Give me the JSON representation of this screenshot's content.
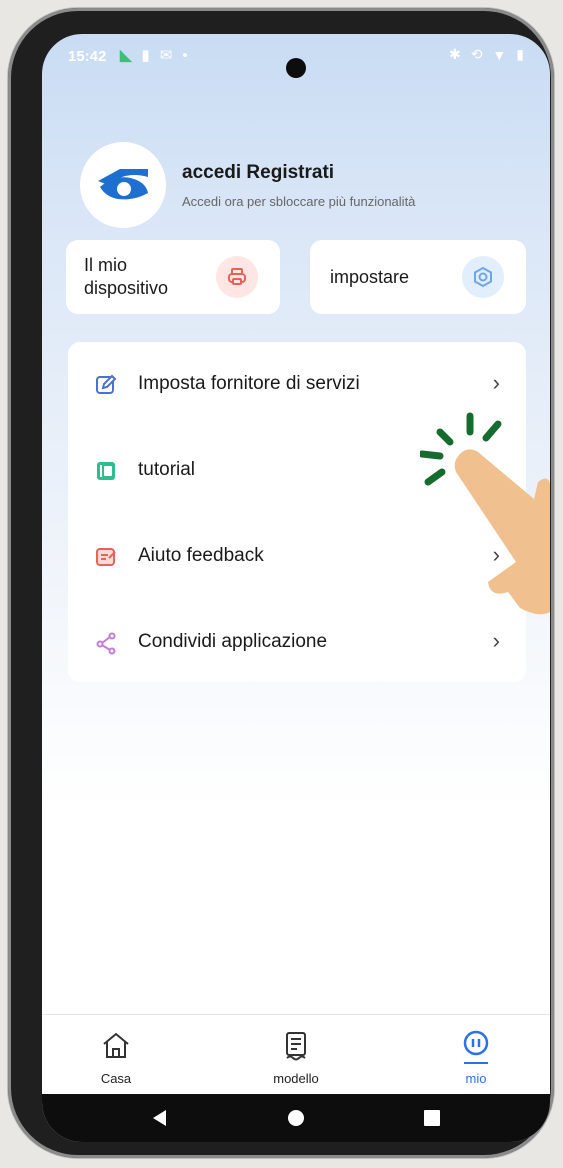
{
  "status_bar": {
    "time": "15:42",
    "left_icons": [
      "calculator-icon",
      "sim-icon",
      "mail-icon",
      "dot-icon"
    ],
    "right_icons": [
      "bluetooth-icon",
      "sync-icon",
      "wifi-icon",
      "battery-icon"
    ]
  },
  "profile": {
    "title": "accedi Registrati",
    "subtitle": "Accedi ora per sbloccare più funzionalità",
    "avatar_icon": "logo-icon"
  },
  "cards": [
    {
      "label": "Il mio dispositivo",
      "icon": "printer-icon"
    },
    {
      "label": "impostare",
      "icon": "settings-icon"
    }
  ],
  "menu": {
    "items": [
      {
        "label": "Imposta fornitore di servizi",
        "icon": "edit-icon"
      },
      {
        "label": "tutorial",
        "icon": "book-icon"
      },
      {
        "label": "Aiuto feedback",
        "icon": "feedback-icon"
      },
      {
        "label": "Condividi applicazione",
        "icon": "share-icon"
      }
    ]
  },
  "tabbar": {
    "tabs": [
      {
        "label": "Casa",
        "icon": "home-icon"
      },
      {
        "label": "modello",
        "icon": "template-icon"
      },
      {
        "label": "mio",
        "icon": "profile-icon"
      }
    ],
    "active": "mio"
  },
  "nav": {
    "buttons": [
      "back-icon",
      "home-dot-icon",
      "recents-icon"
    ]
  },
  "colors": {
    "accent": "#2d6fe6",
    "printer_bg": "#fde6e3",
    "printer_fg": "#e8615a",
    "settings_bg": "#e3eefc",
    "settings_fg": "#6ea6ec",
    "edit": "#4b6fd6",
    "book": "#2ebd8e",
    "feedback": "#e8615a",
    "share": "#c57cd6",
    "hand": "#f1c08f",
    "tap": "#166b2f"
  }
}
